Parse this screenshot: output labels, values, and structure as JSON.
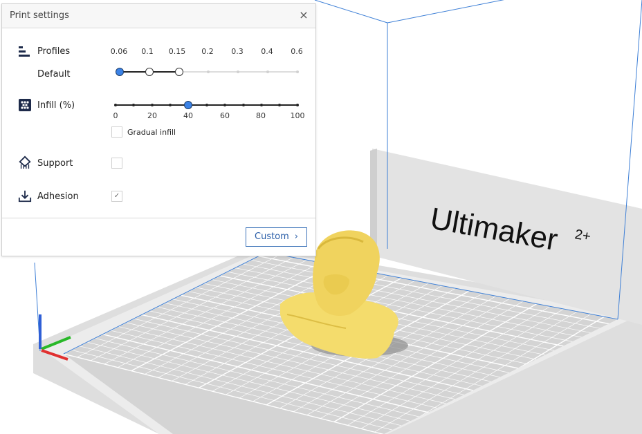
{
  "viewport": {
    "brand_text": "Ultimaker",
    "brand_suffix": "2+"
  },
  "panel": {
    "title": "Print settings",
    "close_glyph": "×",
    "profiles": {
      "label": "Profiles",
      "sublabel": "Default",
      "ticks": [
        "0.06",
        "0.1",
        "0.15",
        "0.2",
        "0.3",
        "0.4",
        "0.6"
      ],
      "selected": "0.06"
    },
    "infill": {
      "label": "Infill (%)",
      "ticks": [
        "0",
        "20",
        "40",
        "60",
        "80",
        "100"
      ],
      "value": 40,
      "gradual_label": "Gradual infill",
      "gradual_checked": false
    },
    "support": {
      "label": "Support",
      "checked": false
    },
    "adhesion": {
      "label": "Adhesion",
      "checked": true,
      "check_glyph": "✓"
    },
    "custom_button": {
      "label": "Custom",
      "chevron": "›"
    }
  },
  "colors": {
    "accent": "#3b82e6",
    "model": "#f4dc6c",
    "build_volume_edge": "#3d7fd6",
    "axis_x": "#e03030",
    "axis_y": "#2f5fd6",
    "axis_z": "#28b828"
  },
  "icons": {
    "profiles": "profiles-bars-icon",
    "infill": "infill-pattern-icon",
    "support": "support-icon",
    "adhesion": "adhesion-download-icon",
    "close": "close-icon",
    "custom_chevron": "chevron-right-icon"
  }
}
